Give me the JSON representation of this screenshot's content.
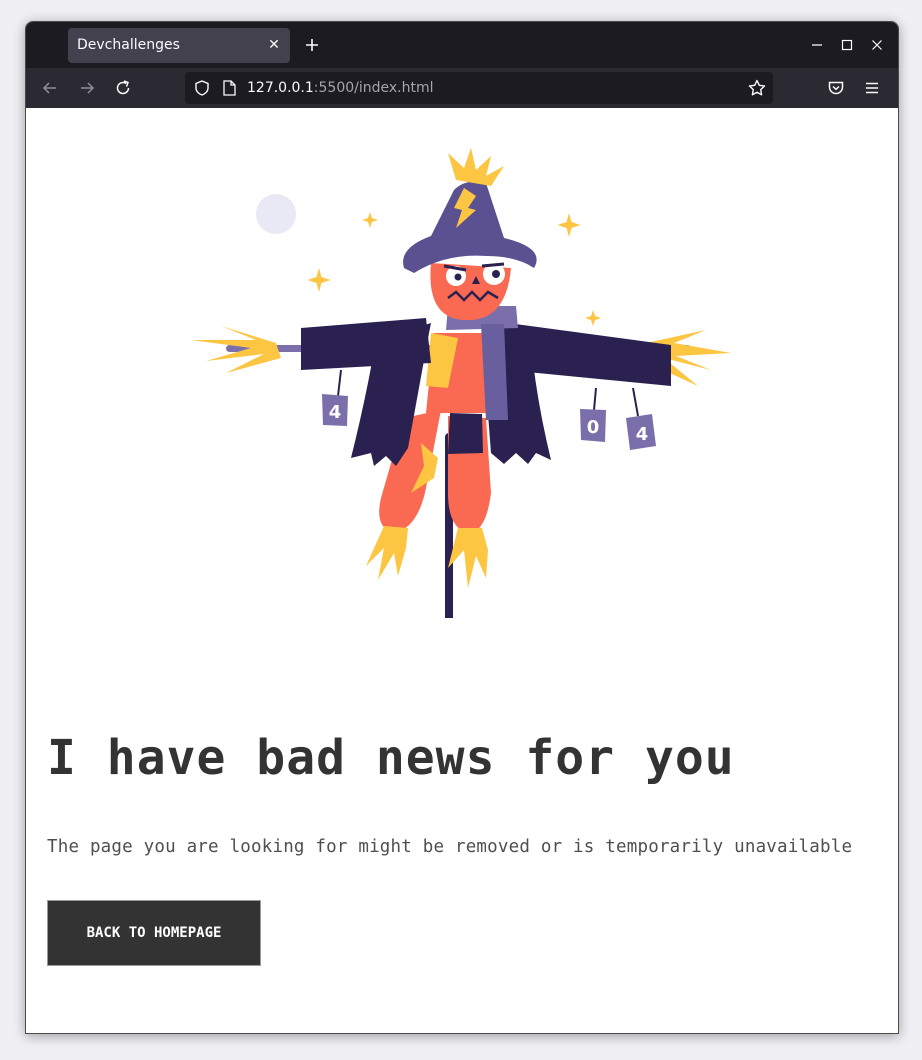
{
  "browser": {
    "tab_title": "Devchallenges",
    "url_host": "127.0.0.1",
    "url_rest": ":5500/index.html"
  },
  "page": {
    "headline": "I have bad news for you",
    "message": "The page you are looking for might be removed or is temporarily unavailable",
    "button_label": "BACK TO HOMEPAGE",
    "illustration": {
      "can_left": "4",
      "can_mid": "0",
      "can_right": "4"
    }
  },
  "colors": {
    "accent_dark": "#333333",
    "scarecrow_coat": "#2b2150",
    "scarecrow_hat": "#5b5190",
    "pumpkin": "#fa6a52",
    "straw": "#fcc643"
  }
}
